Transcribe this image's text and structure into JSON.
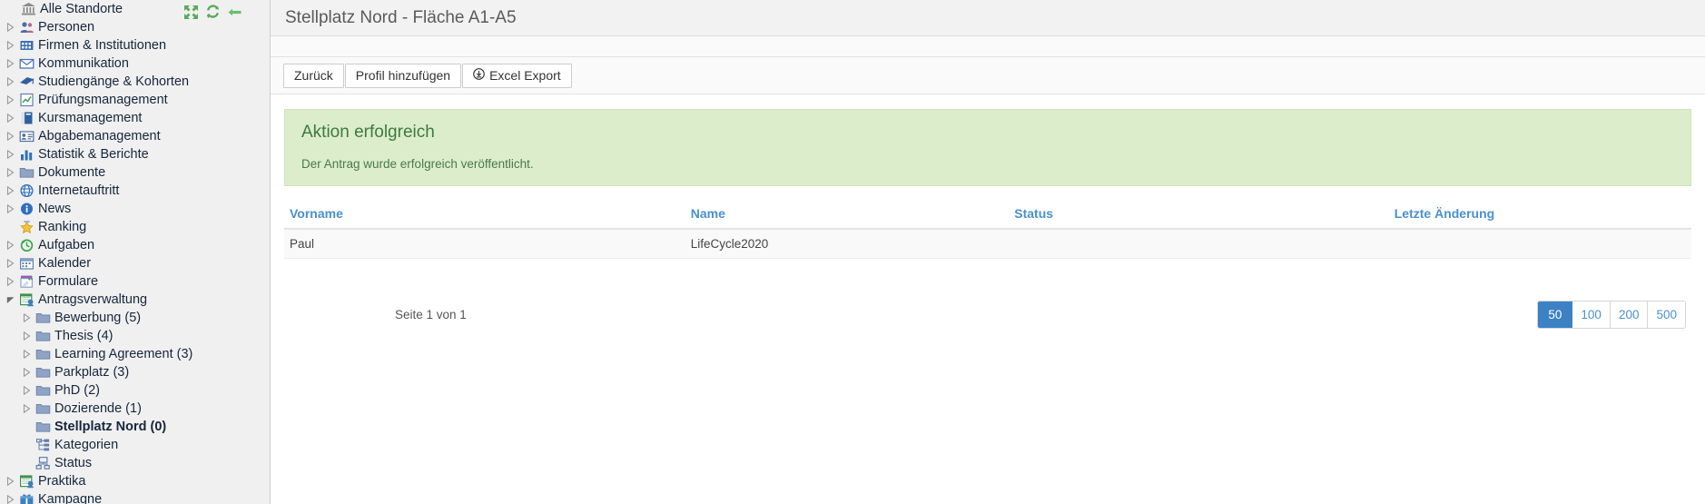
{
  "sidebar": {
    "tools": [
      {
        "name": "collapse-all-icon",
        "title": "Alle einklappen"
      },
      {
        "name": "refresh-icon",
        "title": "Aktualisieren"
      },
      {
        "name": "back-arrow-icon",
        "title": "Zurück"
      }
    ],
    "items": [
      {
        "label": "Alle Standorte",
        "icon": "bank-icon",
        "depth": 0,
        "arrow": "none",
        "bold": false
      },
      {
        "label": "Personen",
        "icon": "people-icon",
        "depth": 1,
        "arrow": "collapsed",
        "bold": false
      },
      {
        "label": "Firmen & Institutionen",
        "icon": "company-icon",
        "depth": 1,
        "arrow": "collapsed",
        "bold": false
      },
      {
        "label": "Kommunikation",
        "icon": "envelope-icon",
        "depth": 1,
        "arrow": "collapsed",
        "bold": false
      },
      {
        "label": "Studiengänge & Kohorten",
        "icon": "graduation-cap-icon",
        "depth": 1,
        "arrow": "collapsed",
        "bold": false
      },
      {
        "label": "Prüfungsmanagement",
        "icon": "exam-chart-icon",
        "depth": 1,
        "arrow": "collapsed",
        "bold": false
      },
      {
        "label": "Kursmanagement",
        "icon": "book-icon",
        "depth": 1,
        "arrow": "collapsed",
        "bold": false
      },
      {
        "label": "Abgabemanagement",
        "icon": "id-card-icon",
        "depth": 1,
        "arrow": "collapsed",
        "bold": false
      },
      {
        "label": "Statistik & Berichte",
        "icon": "bar-chart-icon",
        "depth": 1,
        "arrow": "collapsed",
        "bold": false
      },
      {
        "label": "Dokumente",
        "icon": "folder-icon",
        "depth": 1,
        "arrow": "collapsed",
        "bold": false
      },
      {
        "label": "Internetauftritt",
        "icon": "globe-icon",
        "depth": 1,
        "arrow": "collapsed",
        "bold": false
      },
      {
        "label": "News",
        "icon": "info-icon",
        "depth": 1,
        "arrow": "collapsed",
        "bold": false
      },
      {
        "label": "Ranking",
        "icon": "star-icon",
        "depth": 1,
        "arrow": "none",
        "bold": false
      },
      {
        "label": "Aufgaben",
        "icon": "clock-icon",
        "depth": 1,
        "arrow": "collapsed",
        "bold": false
      },
      {
        "label": "Kalender",
        "icon": "calendar-icon",
        "depth": 1,
        "arrow": "collapsed",
        "bold": false
      },
      {
        "label": "Formulare",
        "icon": "forms-icon",
        "depth": 1,
        "arrow": "collapsed",
        "bold": false
      },
      {
        "label": "Antragsverwaltung",
        "icon": "application-admin-icon",
        "depth": 1,
        "arrow": "expanded",
        "bold": false
      },
      {
        "label": "Bewerbung (5)",
        "icon": "folder-icon",
        "depth": 2,
        "arrow": "collapsed",
        "bold": false
      },
      {
        "label": "Thesis (4)",
        "icon": "folder-icon",
        "depth": 2,
        "arrow": "collapsed",
        "bold": false
      },
      {
        "label": "Learning Agreement (3)",
        "icon": "folder-icon",
        "depth": 2,
        "arrow": "collapsed",
        "bold": false
      },
      {
        "label": "Parkplatz (3)",
        "icon": "folder-icon",
        "depth": 2,
        "arrow": "collapsed",
        "bold": false
      },
      {
        "label": "PhD (2)",
        "icon": "folder-icon",
        "depth": 2,
        "arrow": "collapsed",
        "bold": false
      },
      {
        "label": "Dozierende (1)",
        "icon": "folder-icon",
        "depth": 2,
        "arrow": "collapsed",
        "bold": false
      },
      {
        "label": "Stellplatz Nord (0)",
        "icon": "folder-icon",
        "depth": 2,
        "arrow": "none",
        "bold": true
      },
      {
        "label": "Kategorien",
        "icon": "categories-icon",
        "depth": 2,
        "arrow": "none",
        "bold": false
      },
      {
        "label": "Status",
        "icon": "status-icon",
        "depth": 2,
        "arrow": "none",
        "bold": false
      },
      {
        "label": "Praktika",
        "icon": "internship-icon",
        "depth": 1,
        "arrow": "collapsed",
        "bold": false
      },
      {
        "label": "Kampagne",
        "icon": "campaign-icon",
        "depth": 1,
        "arrow": "collapsed",
        "bold": false
      }
    ]
  },
  "header": {
    "title": "Stellplatz Nord - Fläche A1-A5"
  },
  "toolbar": {
    "back_label": "Zurück",
    "add_profile_label": "Profil hinzufügen",
    "excel_export_label": "Excel Export",
    "excel_export_icon": "download-circle-icon"
  },
  "alert": {
    "title": "Aktion erfolgreich",
    "message": "Der Antrag wurde erfolgreich veröffentlicht.",
    "background_color": "#dcedcc",
    "title_color": "#3d7a3d"
  },
  "table": {
    "columns": [
      "Vorname",
      "Name",
      "Status",
      "Letzte Änderung"
    ],
    "rows": [
      {
        "vorname": "Paul",
        "name": "LifeCycle2020",
        "status": "",
        "letzte_aenderung": ""
      }
    ]
  },
  "pagination": {
    "info": "Seite 1 von 1",
    "page_sizes": [
      "50",
      "100",
      "200",
      "500"
    ],
    "selected_page_size": "50",
    "accent_color": "#3b81c4"
  }
}
